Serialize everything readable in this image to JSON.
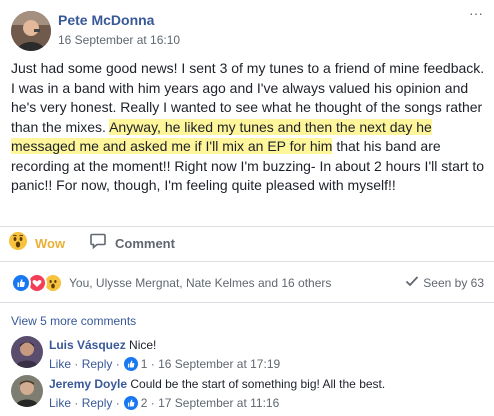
{
  "post": {
    "author": "Pete McDonna",
    "timestamp": "16 September at 16:10",
    "menu_icon": "···",
    "text_before": "Just had some good news! I sent 3 of my tunes to a friend of mine feedback. I was in a band with him years ago and I've always valued his opinion and he's very honest. Really I wanted to see what he thought of the songs rather than the mixes. ",
    "text_highlight": "Anyway, he liked my tunes and then the next day he messaged me and asked me if I'll mix an EP for him",
    "text_after": " that his band are recording at the moment!! Right now I'm buzzing- In about 2 hours I'll start to panic!! For now, though, I'm feeling quite pleased with myself!!",
    "highlight_color": "#fff59a"
  },
  "actions": {
    "wow_label": "Wow",
    "comment_label": "Comment",
    "wow_icon": "wow-emoji-icon",
    "comment_icon": "comment-bubble-icon"
  },
  "reactions": {
    "icons": [
      "like-icon",
      "love-icon",
      "wow-icon"
    ],
    "summary": "You, Ulysse Mergnat, Nate Kelmes and 16 others",
    "seen_by": "Seen by 63"
  },
  "comments": {
    "view_more": "View 5 more comments",
    "items": [
      {
        "name": "Luis Vásquez",
        "text": "Nice!",
        "like": "Like",
        "reply": "Reply",
        "likes": "1",
        "time": "16 September at 17:19"
      },
      {
        "name": "Jeremy Doyle",
        "text": "Could be the start of something big! All the best.",
        "like": "Like",
        "reply": "Reply",
        "likes": "2",
        "time": "17 September at 11:16"
      }
    ]
  },
  "colors": {
    "link_blue": "#385898",
    "wow_yellow": "#e9b038",
    "like_blue": "#1877f2",
    "love_red": "#f33e58"
  }
}
